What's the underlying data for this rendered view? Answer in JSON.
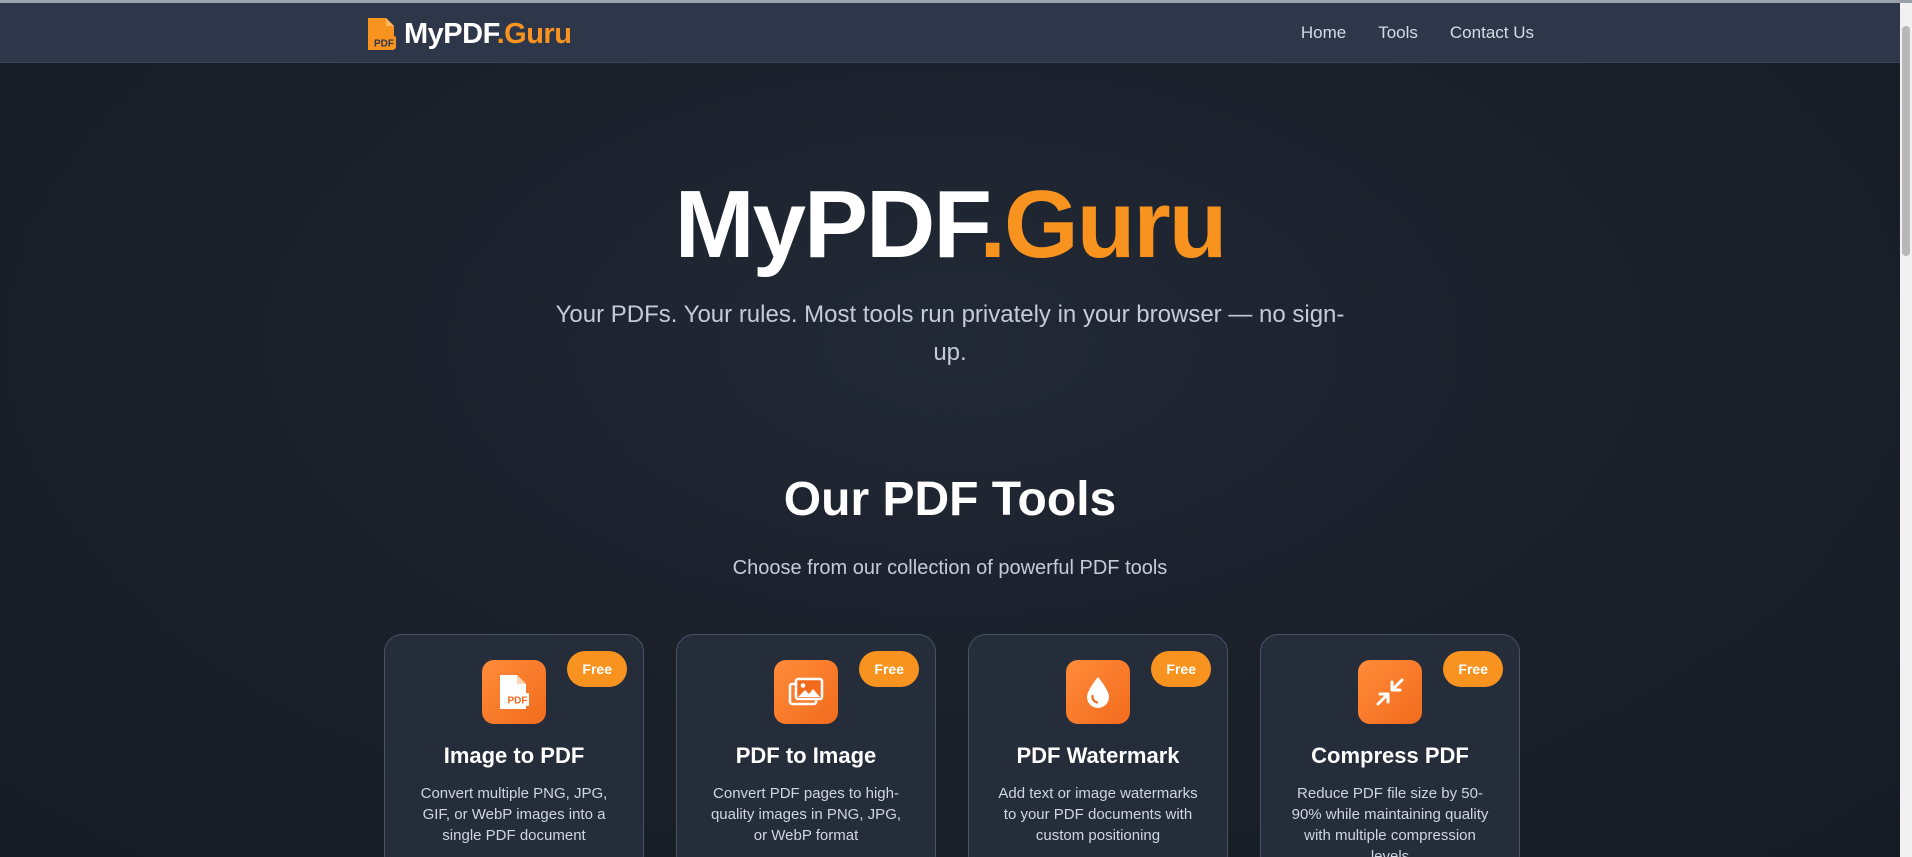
{
  "colors": {
    "accent": "#f7931e",
    "navbar_bg": "#2e3649",
    "page_bg": "#1a1f29",
    "card_bg": "#252c3a"
  },
  "navbar": {
    "brand_part1": "MyPDF",
    "brand_part2": ".Guru",
    "brand_icon": "pdf-file-icon",
    "brand_icon_label": "PDF",
    "links": [
      "Home",
      "Tools",
      "Contact Us"
    ]
  },
  "hero": {
    "title_part1": "MyPDF",
    "title_part2": ".Guru",
    "subtitle": "Your PDFs. Your rules. Most tools run privately in your browser — no sign-up."
  },
  "tools_section": {
    "title": "Our PDF Tools",
    "subtitle": "Choose from our collection of powerful PDF tools",
    "cards": [
      {
        "icon": "file-pdf-icon",
        "icon_label": "PDF",
        "badge": "Free",
        "title": "Image to PDF",
        "description": "Convert multiple PNG, JPG, GIF, or WebP images into a single PDF document"
      },
      {
        "icon": "images-icon",
        "badge": "Free",
        "title": "PDF to Image",
        "description": "Convert PDF pages to high-quality images in PNG, JPG, or WebP format"
      },
      {
        "icon": "droplet-icon",
        "badge": "Free",
        "title": "PDF Watermark",
        "description": "Add text or image watermarks to your PDF documents with custom positioning"
      },
      {
        "icon": "compress-icon",
        "badge": "Free",
        "title": "Compress PDF",
        "description": "Reduce PDF file size by 50-90% while maintaining quality with multiple compression levels"
      }
    ]
  }
}
